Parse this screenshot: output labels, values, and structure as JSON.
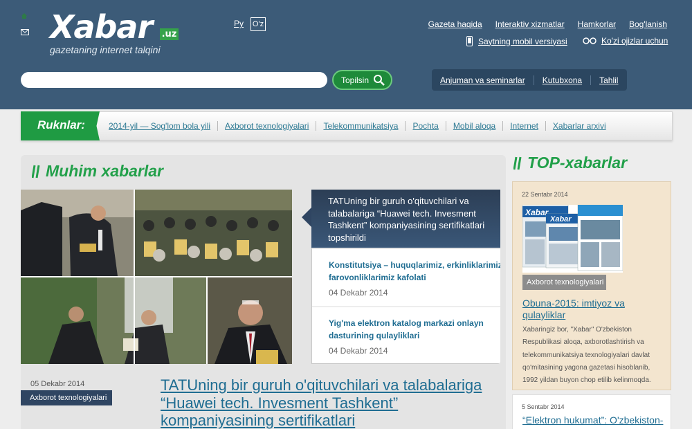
{
  "header": {
    "logo": {
      "word": "Xabar",
      "suffix": ".uz",
      "tagline": "gazetaning internet talqini"
    },
    "lang": {
      "ru": "Ру",
      "uz": "O'z"
    },
    "top_links": [
      "Gazeta haqida",
      "Interaktiv xizmatlar",
      "Hamkorlar",
      "Bog'lanish"
    ],
    "mobile_link": "Saytning mobil versiyasi",
    "impaired_link": "Ko'zi ojizlar uchun",
    "search": {
      "value": "",
      "button": "Topilsin"
    },
    "tabs": [
      "Anjuman va seminarlar",
      "Kutubxona",
      "Tahlil"
    ]
  },
  "rubrics": {
    "label": "Ruknlar:",
    "items": [
      "2014-yil — Sog'lom bola yili",
      "Axborot texnologiyalari",
      "Telekommunikatsiya",
      "Pochta",
      "Mobil aloqa",
      "Internet",
      "Xabarlar arxivi"
    ]
  },
  "main": {
    "title": "Muhim xabarlar",
    "slider": {
      "active": "TATUning bir guruh o'qituvchilari va talabalariga “Huawei tech. Invesment Tashkent” kompaniyasining sertifikatlari topshirildi",
      "items": [
        {
          "title": "Konstitutsiya – huquqlarimiz, erkinliklarimiz, farovonliklarimiz kafolati",
          "date": "04 Dekabr 2014"
        },
        {
          "title": "Yig'ma elektron katalog markazi onlayn dasturining qulayliklari",
          "date": "04 Dekabr 2014"
        }
      ]
    },
    "featured": {
      "date": "05 Dekabr 2014",
      "tag": "Axborot texnologiyalari",
      "title": "TATUning bir guruh o'qituvchilari va talabalariga “Huawei tech. Invesment Tashkent” kompaniyasining sertifikatlari"
    }
  },
  "sidebar": {
    "title": "TOP-xabarlar",
    "card1": {
      "date": "22 Sentabr 2014",
      "tag": "Axborot texnologiyalari",
      "link": "Obuna-2015: imtiyoz va qulayliklar",
      "text": "Xabaringiz bor, \"Xabar\" O'zbekiston Respublikasi aloqa, axborotlashtirish va telekommunikatsiya texnologiyalari davlat qo'mitasining yagona gazetasi hisoblanib, 1992 yildan buyon chop etilib kelinmoqda."
    },
    "card2": {
      "date": "5 Sentabr 2014",
      "link": "“Elektron hukumat”: O'zbekiston-"
    }
  },
  "colors": {
    "header_bg": "#3c5b78",
    "green": "#22a04a",
    "link": "#1f6d92",
    "dark_navy": "#2f4562"
  }
}
